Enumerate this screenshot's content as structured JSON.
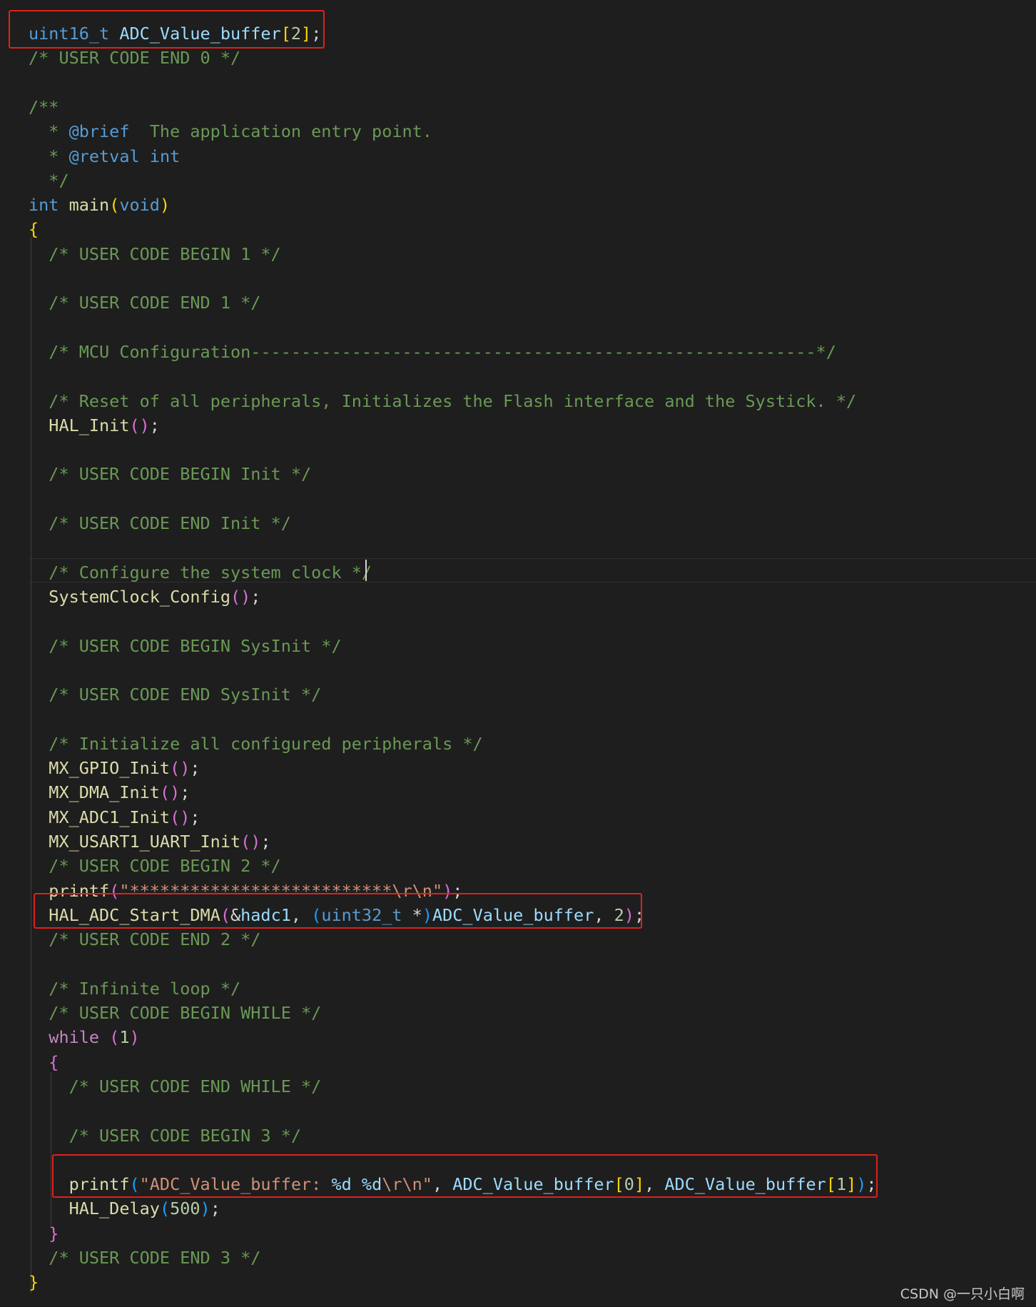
{
  "colors": {
    "background": "#1e1e1e",
    "text": "#d4d4d4",
    "comment": "#6a9955",
    "type_keyword": "#569cd6",
    "control_keyword": "#c586c0",
    "function": "#dcdcaa",
    "variable": "#9cdcfe",
    "string": "#ce9178",
    "number": "#b5cea8",
    "bracket_level1": "#ffd700",
    "bracket_level2": "#da70d6",
    "bracket_level3": "#179fff",
    "highlight_box": "#e0201b"
  },
  "code_lines": [
    [
      [
        "type",
        "uint16_t"
      ],
      [
        "plain",
        " "
      ],
      [
        "var",
        "ADC_Value_buffer"
      ],
      [
        "brace1",
        "["
      ],
      [
        "number",
        "2"
      ],
      [
        "brace1",
        "]"
      ],
      [
        "plain",
        ";"
      ]
    ],
    [
      [
        "comment",
        "/* USER CODE END 0 */"
      ]
    ],
    [],
    [
      [
        "comment",
        "/**"
      ]
    ],
    [
      [
        "comment",
        "  * "
      ],
      [
        "doctag",
        "@brief"
      ],
      [
        "comment",
        "  The application entry point."
      ]
    ],
    [
      [
        "comment",
        "  * "
      ],
      [
        "doctag",
        "@retval"
      ],
      [
        "comment",
        " "
      ],
      [
        "type",
        "int"
      ]
    ],
    [
      [
        "comment",
        "  */"
      ]
    ],
    [
      [
        "type",
        "int"
      ],
      [
        "plain",
        " "
      ],
      [
        "func",
        "main"
      ],
      [
        "brace1",
        "("
      ],
      [
        "type",
        "void"
      ],
      [
        "brace1",
        ")"
      ]
    ],
    [
      [
        "brace1",
        "{"
      ]
    ],
    [
      [
        "comment",
        "  /* USER CODE BEGIN 1 */"
      ]
    ],
    [],
    [
      [
        "comment",
        "  /* USER CODE END 1 */"
      ]
    ],
    [],
    [
      [
        "comment",
        "  /* MCU Configuration--------------------------------------------------------*/"
      ]
    ],
    [],
    [
      [
        "comment",
        "  /* Reset of all peripherals, Initializes the Flash interface and the Systick. */"
      ]
    ],
    [
      [
        "plain",
        "  "
      ],
      [
        "func",
        "HAL_Init"
      ],
      [
        "brace2",
        "()"
      ],
      [
        "plain",
        ";"
      ]
    ],
    [],
    [
      [
        "comment",
        "  /* USER CODE BEGIN Init */"
      ]
    ],
    [],
    [
      [
        "comment",
        "  /* USER CODE END Init */"
      ]
    ],
    [],
    [
      [
        "comment",
        "  /* Configure the system clock */"
      ]
    ],
    [
      [
        "plain",
        "  "
      ],
      [
        "func",
        "SystemClock_Config"
      ],
      [
        "brace2",
        "()"
      ],
      [
        "plain",
        ";"
      ]
    ],
    [],
    [
      [
        "comment",
        "  /* USER CODE BEGIN SysInit */"
      ]
    ],
    [],
    [
      [
        "comment",
        "  /* USER CODE END SysInit */"
      ]
    ],
    [],
    [
      [
        "comment",
        "  /* Initialize all configured peripherals */"
      ]
    ],
    [
      [
        "plain",
        "  "
      ],
      [
        "func",
        "MX_GPIO_Init"
      ],
      [
        "brace2",
        "()"
      ],
      [
        "plain",
        ";"
      ]
    ],
    [
      [
        "plain",
        "  "
      ],
      [
        "func",
        "MX_DMA_Init"
      ],
      [
        "brace2",
        "()"
      ],
      [
        "plain",
        ";"
      ]
    ],
    [
      [
        "plain",
        "  "
      ],
      [
        "func",
        "MX_ADC1_Init"
      ],
      [
        "brace2",
        "()"
      ],
      [
        "plain",
        ";"
      ]
    ],
    [
      [
        "plain",
        "  "
      ],
      [
        "func",
        "MX_USART1_UART_Init"
      ],
      [
        "brace2",
        "()"
      ],
      [
        "plain",
        ";"
      ]
    ],
    [
      [
        "comment",
        "  /* USER CODE BEGIN 2 */"
      ]
    ],
    [
      [
        "plain",
        "  "
      ],
      [
        "func",
        "printf"
      ],
      [
        "brace2",
        "("
      ],
      [
        "string",
        "\"**************************\\r\\n\""
      ],
      [
        "brace2",
        ")"
      ],
      [
        "plain",
        ";"
      ]
    ],
    [
      [
        "plain",
        "  "
      ],
      [
        "func",
        "HAL_ADC_Start_DMA"
      ],
      [
        "brace2",
        "("
      ],
      [
        "plain",
        "&"
      ],
      [
        "var",
        "hadc1"
      ],
      [
        "plain",
        ", "
      ],
      [
        "brace3",
        "("
      ],
      [
        "type",
        "uint32_t"
      ],
      [
        "plain",
        " *"
      ],
      [
        "brace3",
        ")"
      ],
      [
        "var",
        "ADC_Value_buffer"
      ],
      [
        "plain",
        ", "
      ],
      [
        "number",
        "2"
      ],
      [
        "brace2",
        ")"
      ],
      [
        "plain",
        ";"
      ]
    ],
    [
      [
        "comment",
        "  /* USER CODE END 2 */"
      ]
    ],
    [],
    [
      [
        "comment",
        "  /* Infinite loop */"
      ]
    ],
    [
      [
        "comment",
        "  /* USER CODE BEGIN WHILE */"
      ]
    ],
    [
      [
        "plain",
        "  "
      ],
      [
        "keyword",
        "while"
      ],
      [
        "plain",
        " "
      ],
      [
        "brace2",
        "("
      ],
      [
        "number",
        "1"
      ],
      [
        "brace2",
        ")"
      ]
    ],
    [
      [
        "plain",
        "  "
      ],
      [
        "brace2",
        "{"
      ]
    ],
    [
      [
        "comment",
        "    /* USER CODE END WHILE */"
      ]
    ],
    [],
    [
      [
        "comment",
        "    /* USER CODE BEGIN 3 */"
      ]
    ],
    [],
    [
      [
        "plain",
        "    "
      ],
      [
        "func",
        "printf"
      ],
      [
        "brace3",
        "("
      ],
      [
        "string",
        "\"ADC_Value_buffer: "
      ],
      [
        "var",
        "%d"
      ],
      [
        "string",
        " "
      ],
      [
        "var",
        "%d"
      ],
      [
        "string",
        "\\r\\n\""
      ],
      [
        "plain",
        ", "
      ],
      [
        "var",
        "ADC_Value_buffer"
      ],
      [
        "brace1",
        "["
      ],
      [
        "number",
        "0"
      ],
      [
        "brace1",
        "]"
      ],
      [
        "plain",
        ", "
      ],
      [
        "var",
        "ADC_Value_buffer"
      ],
      [
        "brace1",
        "["
      ],
      [
        "number",
        "1"
      ],
      [
        "brace1",
        "]"
      ],
      [
        "brace3",
        ")"
      ],
      [
        "plain",
        ";"
      ]
    ],
    [
      [
        "plain",
        "    "
      ],
      [
        "func",
        "HAL_Delay"
      ],
      [
        "brace3",
        "("
      ],
      [
        "number",
        "500"
      ],
      [
        "brace3",
        ")"
      ],
      [
        "plain",
        ";"
      ]
    ],
    [
      [
        "plain",
        "  "
      ],
      [
        "brace2",
        "}"
      ]
    ],
    [
      [
        "comment",
        "  /* USER CODE END 3 */"
      ]
    ],
    [
      [
        "brace1",
        "}"
      ]
    ]
  ],
  "watermark": "CSDN @一只小白啊"
}
